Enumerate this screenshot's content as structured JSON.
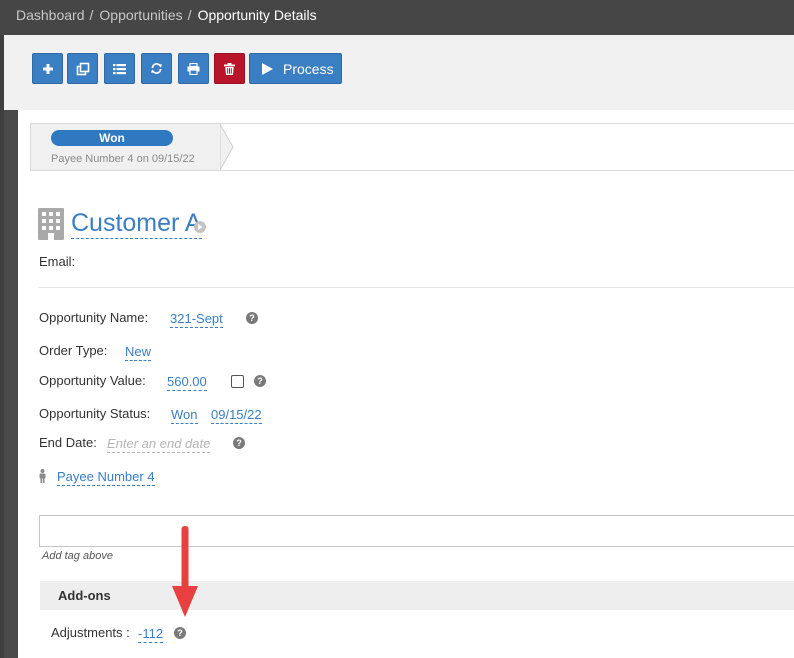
{
  "breadcrumb": {
    "items": [
      "Dashboard",
      "Opportunities"
    ],
    "separator": "/",
    "current": "Opportunity Details"
  },
  "toolbar": {
    "buttons": [
      {
        "icon": "plus-icon"
      },
      {
        "icon": "copy-icon"
      },
      {
        "icon": "list-icon"
      },
      {
        "icon": "refresh-icon"
      },
      {
        "icon": "print-icon"
      },
      {
        "icon": "trash-icon"
      }
    ],
    "process_label": "Process",
    "accent_color": "#3a7ec3",
    "danger_color": "#b8152b"
  },
  "stage": {
    "label": "Won",
    "subtitle": "Payee Number 4 on 09/15/22"
  },
  "customer": {
    "name": "Customer A",
    "email_label": "Email:"
  },
  "fields": {
    "opportunity_name": {
      "label": "Opportunity Name:",
      "value": "321-Sept"
    },
    "order_type": {
      "label": "Order Type:",
      "value": "New"
    },
    "opportunity_value": {
      "label": "Opportunity Value:",
      "value": "560.00"
    },
    "opportunity_status": {
      "label": "Opportunity Status:",
      "value": "Won",
      "date": "09/15/22"
    },
    "end_date": {
      "label": "End Date:",
      "placeholder": "Enter an end date"
    }
  },
  "payee": {
    "name": "Payee Number 4"
  },
  "tags": {
    "hint": "Add tag above"
  },
  "addons": {
    "title": "Add-ons",
    "adjustments_label": "Adjustments :",
    "adjustments_value": "-112"
  },
  "help_glyph": "?"
}
